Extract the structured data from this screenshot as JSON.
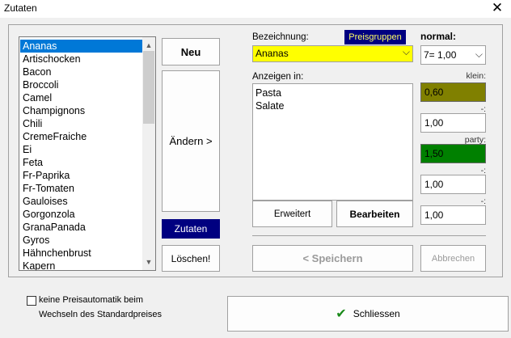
{
  "window": {
    "title": "Zutaten",
    "close_glyph": "✕"
  },
  "ingredients": {
    "items": [
      "Ananas",
      "Artischocken",
      "Bacon",
      "Broccoli",
      "Camel",
      "Champignons",
      "Chili",
      "CremeFraiche",
      "Ei",
      "Feta",
      "Fr-Paprika",
      "Fr-Tomaten",
      "Gauloises",
      "Gorgonzola",
      "GranaPanada",
      "Gyros",
      "Hähnchenbrust",
      "Kapern"
    ],
    "selected": "Ananas"
  },
  "buttons": {
    "neu": "Neu",
    "aendern": "Ändern >",
    "zutaten": "Zutaten",
    "loeschen": "Löschen!",
    "erweitert": "Erweitert",
    "bearbeiten": "Bearbeiten",
    "speichern": "< Speichern",
    "abbrechen": "Abbrechen",
    "schliessen": "Schliessen",
    "preisgruppen": "Preisgruppen"
  },
  "bezeichnung": {
    "label": "Bezeichnung:",
    "value": "Ananas"
  },
  "anzeigen": {
    "label": "Anzeigen in:",
    "items": [
      "Pasta",
      "Salate"
    ]
  },
  "prices": {
    "normal_label": "normal:",
    "normal_value": "7= 1,00",
    "klein_label": "klein:",
    "klein_value": "0,60",
    "sep1": "-:",
    "field1": "1,00",
    "party_label": "party:",
    "party_value": "1,50",
    "sep2": "-:",
    "field2": "1,00",
    "sep3": "-:",
    "field3": "1,00"
  },
  "footer": {
    "checkbox_line1": "keine Preisautomatik beim",
    "checkbox_line2": "Wechseln des Standardpreises"
  },
  "colors": {
    "selection": "#0078d7",
    "zutaten_bg": "#000080",
    "bezeichnung_bg": "#ffff00",
    "klein_bg": "#808000",
    "party_bg": "#008000",
    "check_green": "#1a8a1a"
  }
}
